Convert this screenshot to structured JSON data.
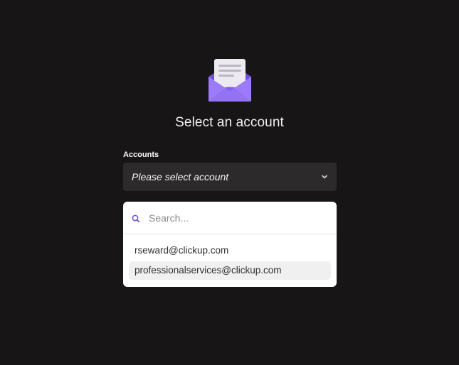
{
  "header": {
    "icon": "open-envelope-icon",
    "title": "Select an account"
  },
  "accounts_field": {
    "label": "Accounts",
    "selected_value": "Please select account",
    "chevron_icon": "chevron-down-icon"
  },
  "dropdown": {
    "search": {
      "icon": "search-icon",
      "placeholder": "Search...",
      "value": ""
    },
    "options": [
      {
        "label": "rseward@clickup.com",
        "highlighted": false
      },
      {
        "label": "professionalservices@clickup.com",
        "highlighted": true
      }
    ]
  },
  "colors": {
    "background": "#171516",
    "envelope_accent": "#8b66f5",
    "search_icon": "#6b4fe0",
    "select_background": "#2c2a2b",
    "highlight": "#f0f0f0"
  }
}
